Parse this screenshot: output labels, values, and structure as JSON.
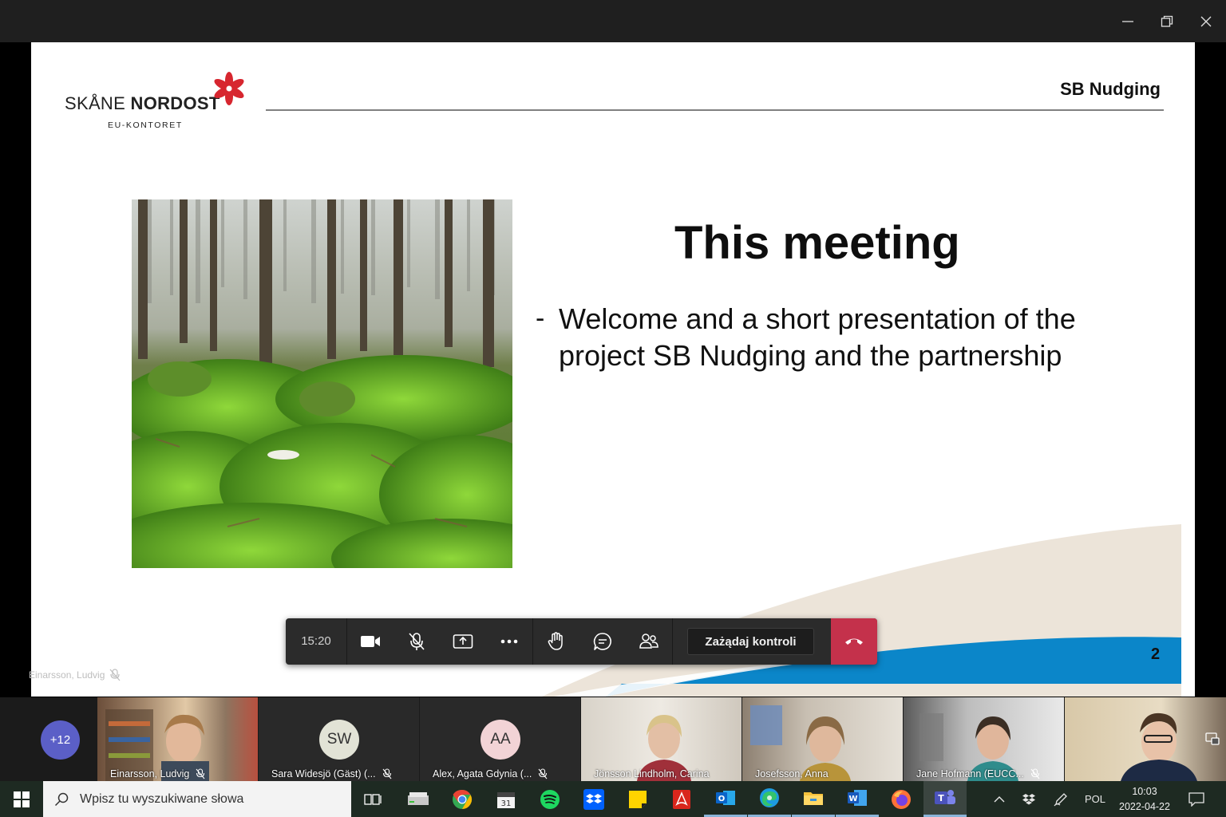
{
  "window": {
    "minimize_icon": "minimize-icon",
    "maximize_icon": "restore-icon",
    "close_icon": "close-icon"
  },
  "slide": {
    "logo_text_regular": "SKÅNE ",
    "logo_text_bold": "NORDOST",
    "logo_sub": "EU-KONTORET",
    "project_tag": "SB Nudging",
    "heading": "This meeting",
    "bullet_dash": "-",
    "bullet_text": "Welcome and a short presentation of the project SB Nudging and the partnership",
    "page_number": "2",
    "colors": {
      "logo_flower": "#d7262f",
      "wave_blue": "#0b86c9",
      "wave_beige": "#ece4d9"
    }
  },
  "presenter": {
    "name": "Einarsson, Ludvig"
  },
  "controls": {
    "timer": "15:20",
    "request_control_label": "Zażądaj kontroli",
    "colors": {
      "bar": "#2b2b2b",
      "hangup": "#c4314b"
    }
  },
  "participants": {
    "overflow_count": "+12",
    "tiles": [
      {
        "name": "Einarsson, Ludvig",
        "type": "video",
        "muted": true
      },
      {
        "name": "Sara Widesjö (Gäst) (...",
        "type": "avatar",
        "initials": "SW",
        "muted": true
      },
      {
        "name": "Alex, Agata Gdynia (...",
        "type": "avatar",
        "initials": "AA",
        "muted": true
      },
      {
        "name": "Jönsson Lindholm, Carina",
        "type": "video",
        "muted": false
      },
      {
        "name": "Josefsson, Anna",
        "type": "video",
        "muted": false
      },
      {
        "name": "Jane Hofmann (EUCC...",
        "type": "video",
        "muted": true
      },
      {
        "name": "",
        "type": "video",
        "muted": false
      }
    ]
  },
  "taskbar": {
    "search_placeholder": "Wpisz tu wyszukiwane słowa",
    "language": "POL",
    "time": "10:03",
    "date": "2022-04-22"
  }
}
